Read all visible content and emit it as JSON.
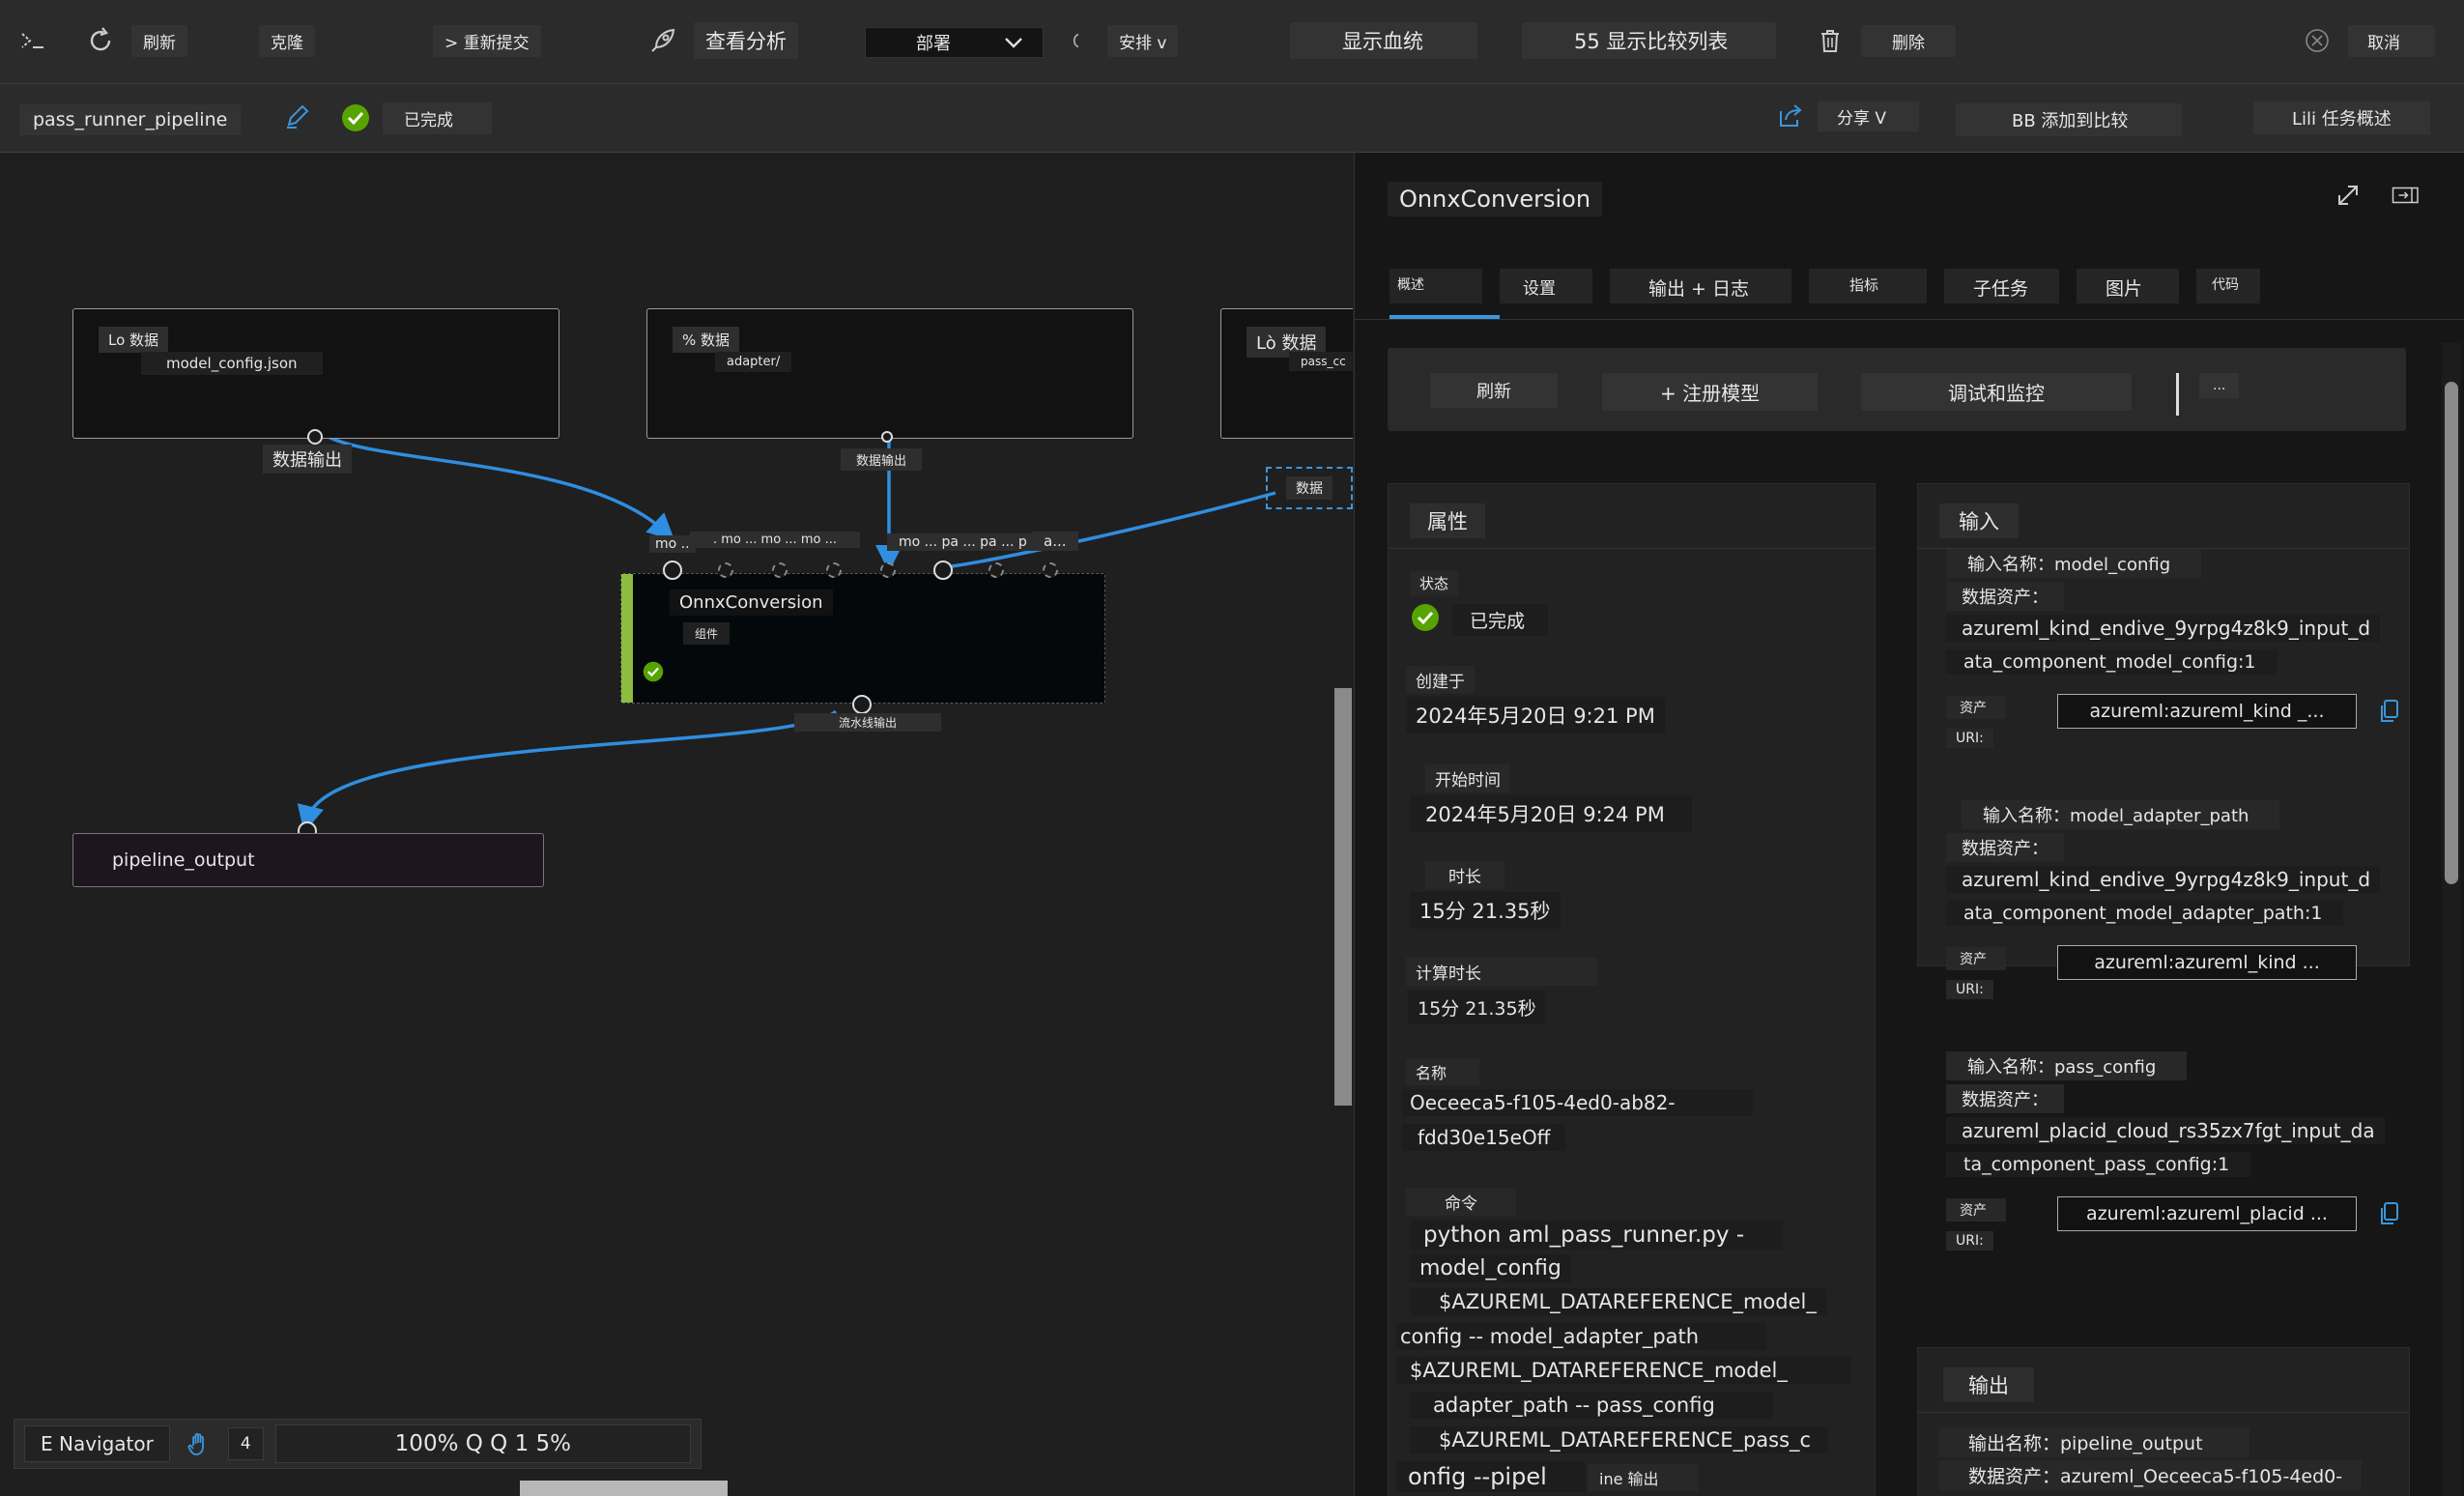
{
  "toolbar": {
    "refresh": "刷新",
    "clone": "克隆",
    "resubmit": "> 重新提交",
    "view_analysis": "查看分析",
    "deploy": "部署",
    "schedule": "安排 v",
    "show_lineage": "显示血统",
    "compare_list": "55 显示比较列表",
    "delete": "删除",
    "cancel": "取消"
  },
  "subbar": {
    "pipeline_name": "pass_runner_pipeline",
    "status": "已完成",
    "share": "分享 V",
    "add_to_compare": "BB 添加到比较",
    "job_overview": "Lili 任务概述"
  },
  "graph": {
    "nodes": [
      {
        "tag": "Lo 数据",
        "sub": "model_config.json",
        "output": "数据输出"
      },
      {
        "tag": "% 数据",
        "sub": "adapter/",
        "output": "数据输出"
      },
      {
        "tag": "Lò 数据",
        "sub": "pass_cc",
        "output": "数据"
      }
    ],
    "port_labels": {
      "p1": "mo ..",
      "p2": ". mo ... mo ... mo ...",
      "p3": "mo ... pa ... pa ... p",
      "p4": "a..."
    },
    "main_node": {
      "title": "OnnxConversion",
      "subtitle": "组件",
      "output": "流水线输出"
    },
    "output_node": {
      "title": "pipeline_output"
    }
  },
  "navigator": {
    "label": "E Navigator",
    "num": "4",
    "zoom": "100% Q Q 1 5%"
  },
  "panel": {
    "title": "OnnxConversion",
    "tabs": [
      "概述",
      "设置",
      "输出 + 日志",
      "指标",
      "子任务",
      "图片",
      "代码"
    ],
    "actions": {
      "refresh": "刷新",
      "register": "+ 注册模型",
      "debug": "调试和监控",
      "more": "..."
    },
    "properties": {
      "header": "属性",
      "status_label": "状态",
      "status": "已完成",
      "created_label": "创建于",
      "created": "2024年5月20日 9:21 PM",
      "start_label": "开始时间",
      "start": "2024年5月20日 9:24 PM",
      "duration_label": "时长",
      "duration": "15分 21.35秒",
      "compute_label": "计算时长",
      "compute": "15分 21.35秒",
      "name_label": "名称",
      "name_1": "Oeceeca5-f105-4ed0-ab82-",
      "name_2": "fdd30e15eOff",
      "command_label": "命令",
      "command": [
        "python aml_pass_runner.py -",
        "model_config",
        "$AZUREML_DATAREFERENCE_model_",
        "config -- model_adapter_path",
        "$AZUREML_DATAREFERENCE_model_",
        "adapter_path -- pass_config",
        "$AZUREML_DATAREFERENCE_pass_c",
        "onfig --pipel"
      ],
      "cmd_tail": "ine 输出"
    },
    "inputs": {
      "header": "输入",
      "asset_label": "资产",
      "uri_label": "URI:",
      "items": [
        {
          "name": "输入名称：model_config",
          "asset_label": "数据资产：",
          "asset_1": "azureml_kind_endive_9yrpg4z8k9_input_d",
          "asset_2": "ata_component_model_config:1",
          "box": "azureml:azureml_kind _..."
        },
        {
          "name": "输入名称：model_adapter_path",
          "asset_label": "数据资产：",
          "asset_1": "azureml_kind_endive_9yrpg4z8k9_input_d",
          "asset_2": "ata_component_model_adapter_path:1",
          "box": "azureml:azureml_kind ..."
        },
        {
          "name": "输入名称：pass_config",
          "asset_label": "数据资产：",
          "asset_1": "azureml_placid_cloud_rs35zx7fgt_input_da",
          "asset_2": "ta_component_pass_config:1",
          "box": "azureml:azureml_placid ..."
        }
      ]
    },
    "outputs": {
      "header": "输出",
      "name": "输出名称：pipeline_output",
      "asset": "数据资产：azureml_Oeceeca5-f105-4ed0-"
    }
  },
  "colors": {
    "accent": "#3a96dd",
    "success": "#57a300",
    "edge": "#2f8ee0"
  }
}
